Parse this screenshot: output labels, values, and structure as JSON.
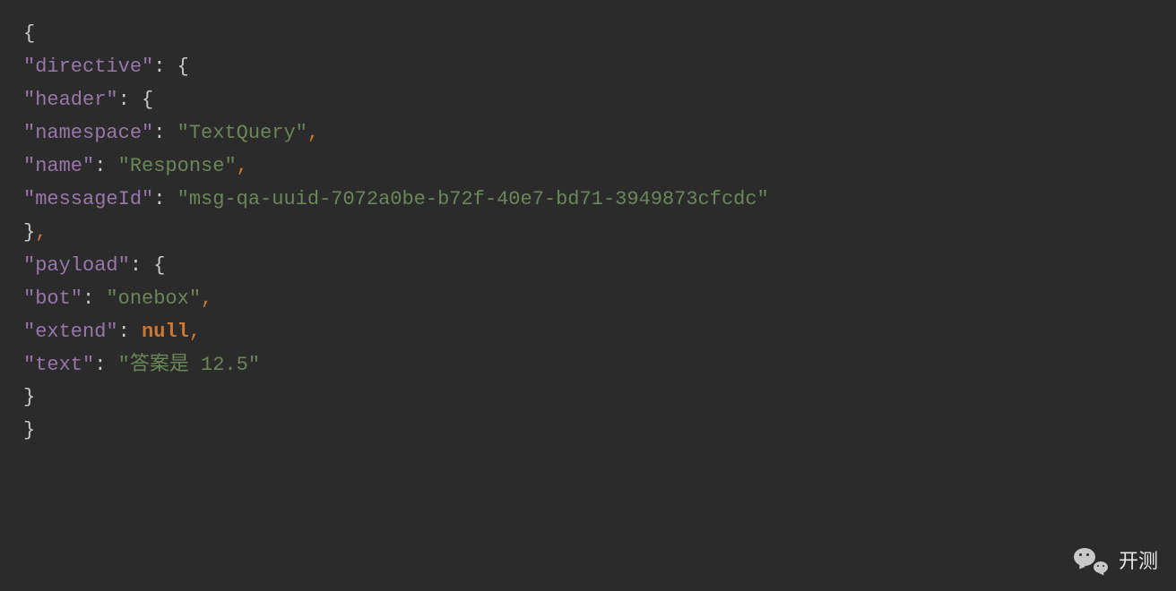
{
  "code": {
    "line1_brace": "{",
    "line2_key": "\"directive\"",
    "line2_colon": ":",
    "line2_brace": " {",
    "line3_key": "\"header\"",
    "line3_colon": ":",
    "line3_brace": " {",
    "line4_key": "\"namespace\"",
    "line4_colon": ":",
    "line4_value": " \"TextQuery\"",
    "line4_comma": ",",
    "line5_key": "\"name\"",
    "line5_colon": ":",
    "line5_value": " \"Response\"",
    "line5_comma": ",",
    "line6_key": "\"messageId\"",
    "line6_colon": ":",
    "line6_value": " \"msg-qa-uuid-7072a0be-b72f-40e7-bd71-3949873cfcdc\"",
    "line7_brace": "}",
    "line7_comma": ",",
    "line8_key": "\"payload\"",
    "line8_colon": ":",
    "line8_brace": " {",
    "line9_key": "\"bot\"",
    "line9_colon": ":",
    "line9_value": " \"onebox\"",
    "line9_comma": ",",
    "line10_key": "\"extend\"",
    "line10_colon": ": ",
    "line10_value": "null",
    "line10_comma": ",",
    "line11_key": "\"text\"",
    "line11_colon": ":",
    "line11_value": " \"答案是 12.5\"",
    "line12_brace": "}",
    "line13_brace": "}"
  },
  "watermark": {
    "label": "开测"
  }
}
